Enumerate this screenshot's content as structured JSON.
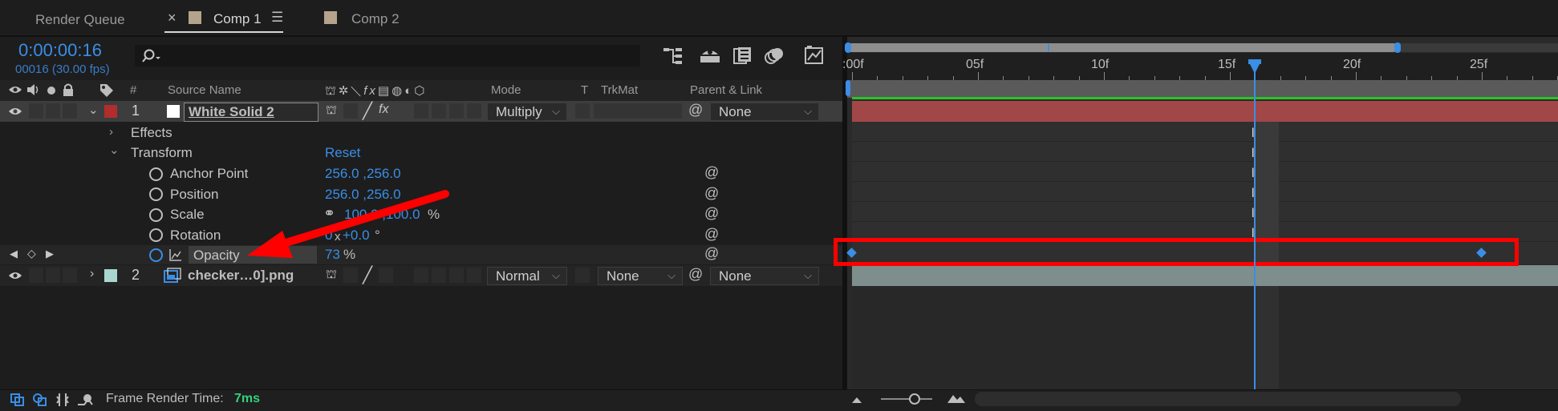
{
  "tabs": [
    {
      "label": "Render Queue"
    },
    {
      "label": "Comp 1",
      "close": "×",
      "menu": "☰"
    },
    {
      "label": "Comp 2"
    }
  ],
  "timecode": "0:00:00:16",
  "frame_info": "00016 (30.00 fps)",
  "search": {
    "icon": "search-icon",
    "placeholder": ""
  },
  "columns": {
    "num": "#",
    "source_name": "Source Name",
    "mode": "Mode",
    "t": "T",
    "trkmat": "TrkMat",
    "parent": "Parent & Link"
  },
  "layers": [
    {
      "index": "1",
      "name": "White Solid 2",
      "mode": "Multiply",
      "trkmat": "",
      "parent": "None",
      "label_color": "#b22d2d"
    },
    {
      "index": "2",
      "name": "checker…0].png",
      "mode": "Normal",
      "trkmat": "None",
      "parent": "None",
      "label_color": "#a9d7d0"
    }
  ],
  "groups": {
    "effects": "Effects",
    "transform": "Transform",
    "reset": "Reset"
  },
  "properties": [
    {
      "name": "Anchor Point",
      "value": "256.0 ,256.0",
      "unit": ""
    },
    {
      "name": "Position",
      "value": "256.0 ,256.0",
      "unit": ""
    },
    {
      "name": "Scale",
      "value": "100.0 ,100.0",
      "unit": "%"
    },
    {
      "name": "Rotation",
      "value_a": "0",
      "value_x": "x",
      "value_b": "+0.0",
      "unit": "°"
    },
    {
      "name": "Opacity",
      "value": "73",
      "unit": "%"
    }
  ],
  "ruler": {
    "labels": [
      ":00f",
      "05f",
      "10f",
      "15f",
      "20f",
      "25f"
    ]
  },
  "playhead_frame": 16,
  "keyframes_frames": [
    0,
    25
  ],
  "footer": {
    "label": "Frame Render Time:",
    "value": "7ms"
  },
  "colors": {
    "accent": "#3a8ee6",
    "annotation_red": "#ff0000",
    "layer1_bar": "#a14747",
    "layer2_bar": "#7d8e8c",
    "green_line": "#29c329",
    "render_time": "#33d17a"
  }
}
